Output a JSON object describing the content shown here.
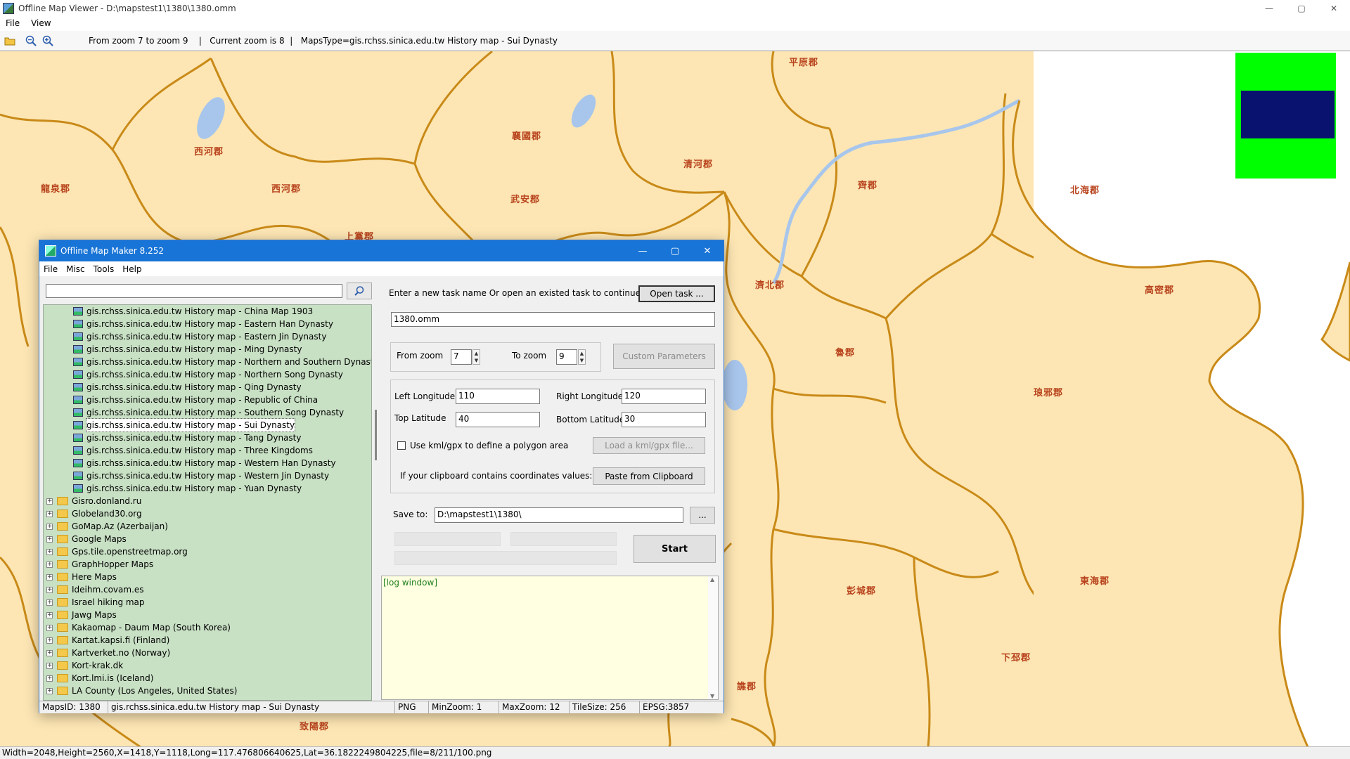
{
  "main": {
    "title": "Offline Map Viewer - D:\\mapstest1\\1380\\1380.omm",
    "menu": [
      "File",
      "View"
    ],
    "toolbar_info": "From zoom 7 to zoom 9    |   Current zoom is 8  |   MapsType=gis.rchss.sinica.edu.tw History map - Sui Dynasty",
    "status": "Width=2048,Height=2560,X=1418,Y=1118,Long=117.476806640625,Lat=36.1822249804225,file=8/211/100.png",
    "win_controls": {
      "min": "—",
      "max": "▢",
      "close": "✕"
    }
  },
  "map": {
    "labels": [
      "平原郡",
      "襄國郡",
      "清河郡",
      "西河郡",
      "西河郡",
      "龍泉郡",
      "武安郡",
      "上黨郡",
      "齊郡",
      "北海郡",
      "濟北郡",
      "高密郡",
      "魯郡",
      "琅邪郡",
      "彭城郡",
      "東海郡",
      "下邳郡",
      "譙郡",
      "致陽郡"
    ],
    "colors": {
      "land": "#fde6b4",
      "border": "#c98a18",
      "water": "#a8c6ec",
      "label": "#b8431d"
    },
    "minimap": {
      "bg": "#00ff00",
      "viewport": "#0a1270"
    }
  },
  "dialog": {
    "title": "Offline Map Maker 8.252",
    "menu": [
      "File",
      "Misc",
      "Tools",
      "Help"
    ],
    "search_placeholder": "",
    "tree_sub": [
      "gis.rchss.sinica.edu.tw History map - China Map 1903",
      "gis.rchss.sinica.edu.tw History map - Eastern Han Dynasty",
      "gis.rchss.sinica.edu.tw History map - Eastern Jin Dynasty",
      "gis.rchss.sinica.edu.tw History map - Ming Dynasty",
      "gis.rchss.sinica.edu.tw History map - Northern and Southern Dynasty",
      "gis.rchss.sinica.edu.tw History map - Northern Song Dynasty",
      "gis.rchss.sinica.edu.tw History map - Qing Dynasty",
      "gis.rchss.sinica.edu.tw History map - Republic of China",
      "gis.rchss.sinica.edu.tw History map - Southern Song Dynasty",
      "gis.rchss.sinica.edu.tw History map - Sui Dynasty",
      "gis.rchss.sinica.edu.tw History map - Tang Dynasty",
      "gis.rchss.sinica.edu.tw History map - Three Kingdoms",
      "gis.rchss.sinica.edu.tw History map - Western Han Dynasty",
      "gis.rchss.sinica.edu.tw History map - Western Jin Dynasty",
      "gis.rchss.sinica.edu.tw History map - Yuan Dynasty"
    ],
    "tree_selected": "gis.rchss.sinica.edu.tw History map - Sui Dynasty",
    "tree_roots": [
      "Gisro.donland.ru",
      "Globeland30.org",
      "GoMap.Az (Azerbaijan)",
      "Google Maps",
      "Gps.tile.openstreetmap.org",
      "GraphHopper Maps",
      "Here Maps",
      "Ideihm.covam.es",
      "Israel hiking map",
      "Jawg Maps",
      "Kakaomap - Daum Map (South Korea)",
      "Kartat.kapsi.fi (Finland)",
      "Kartverket.no (Norway)",
      "Kort-krak.dk",
      "Kort.lmi.is (Iceland)",
      "LA County (Los Angeles, United States)"
    ],
    "task_prompt": "Enter a new task name Or open an existed task to continue:",
    "open_task": "Open task ...",
    "task_name": "1380.omm",
    "from_zoom_label": "From zoom",
    "from_zoom": "7",
    "to_zoom_label": "To zoom",
    "to_zoom": "9",
    "custom_params": "Custom Parameters",
    "left_lon_label": "Left Longitude",
    "left_lon": "110",
    "right_lon_label": "Right Longitude",
    "right_lon": "120",
    "top_lat_label": "Top Latitude",
    "top_lat": "40",
    "bottom_lat_label": "Bottom Latitude",
    "bottom_lat": "30",
    "kml_label": "Use kml/gpx to define a polygon area",
    "kml_btn": "Load a kml/gpx file...",
    "clip_label": "If your clipboard contains coordinates values:",
    "clip_btn": "Paste from Clipboard",
    "save_label": "Save to:",
    "save_path": "D:\\mapstest1\\1380\\",
    "browse": "...",
    "start": "Start",
    "log": "[log window]",
    "status": [
      "MapsID: 1380",
      "gis.rchss.sinica.edu.tw History map - Sui Dynasty",
      "PNG",
      "MinZoom: 1",
      "MaxZoom: 12",
      "TileSize: 256",
      "EPSG:3857"
    ]
  }
}
